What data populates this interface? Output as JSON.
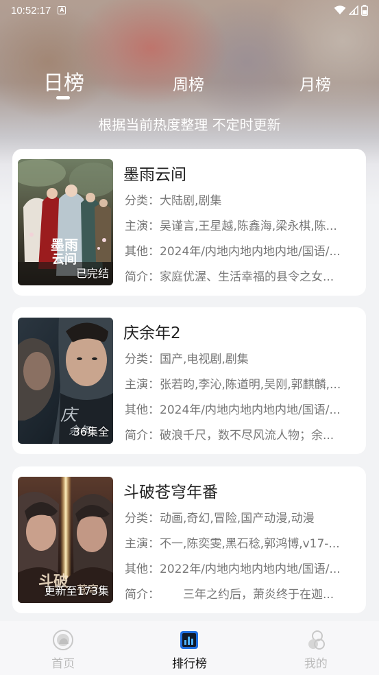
{
  "status_bar": {
    "time": "10:52:17",
    "notification_icon": "a-badge-icon"
  },
  "tabs": [
    {
      "label": "日榜",
      "active": true
    },
    {
      "label": "周榜",
      "active": false
    },
    {
      "label": "月榜",
      "active": false
    }
  ],
  "subtitle": "根据当前热度整理 不定时更新",
  "items": [
    {
      "title": "墨雨云间",
      "badge": "已完结",
      "category_label": "分类：",
      "category": "大陆剧,剧集",
      "cast_label": "主演：",
      "cast": "吴谨言,王星越,陈鑫海,梁永棋,陈...",
      "other_label": "其他：",
      "other": "2024年/内地内地内地内地/国语/...",
      "intro_label": "简介：",
      "intro": "家庭优渥、生活幸福的县令之女..."
    },
    {
      "title": "庆余年2",
      "badge": "36集全",
      "category_label": "分类：",
      "category": "国产,电视剧,剧集",
      "cast_label": "主演：",
      "cast": "张若昀,李沁,陈道明,吴刚,郭麒麟,...",
      "other_label": "其他：",
      "other": "2024年/内地内地内地内地/国语/...",
      "intro_label": "简介：",
      "intro": "破浪千尺，数不尽风流人物；余..."
    },
    {
      "title": "斗破苍穹年番",
      "badge": "更新至173集",
      "category_label": "分类：",
      "category": "动画,奇幻,冒险,国产动漫,动漫",
      "cast_label": "主演：",
      "cast": "不一,陈奕雯,黑石稔,郭鸿博,v17-...",
      "other_label": "其他：",
      "other": "2022年/内地内地内地内地/国语/...",
      "intro_label": "简介：",
      "intro": "　　三年之约后，萧炎终于在迦..."
    }
  ],
  "nav": [
    {
      "label": "首页",
      "icon": "home-icon",
      "active": false
    },
    {
      "label": "排行榜",
      "icon": "ranking-icon",
      "active": true
    },
    {
      "label": "我的",
      "icon": "profile-icon",
      "active": false
    }
  ],
  "colors": {
    "accent": "#1f6fe0",
    "text_primary": "#222222",
    "text_secondary": "#777777",
    "nav_inactive": "#bbbbbb"
  }
}
